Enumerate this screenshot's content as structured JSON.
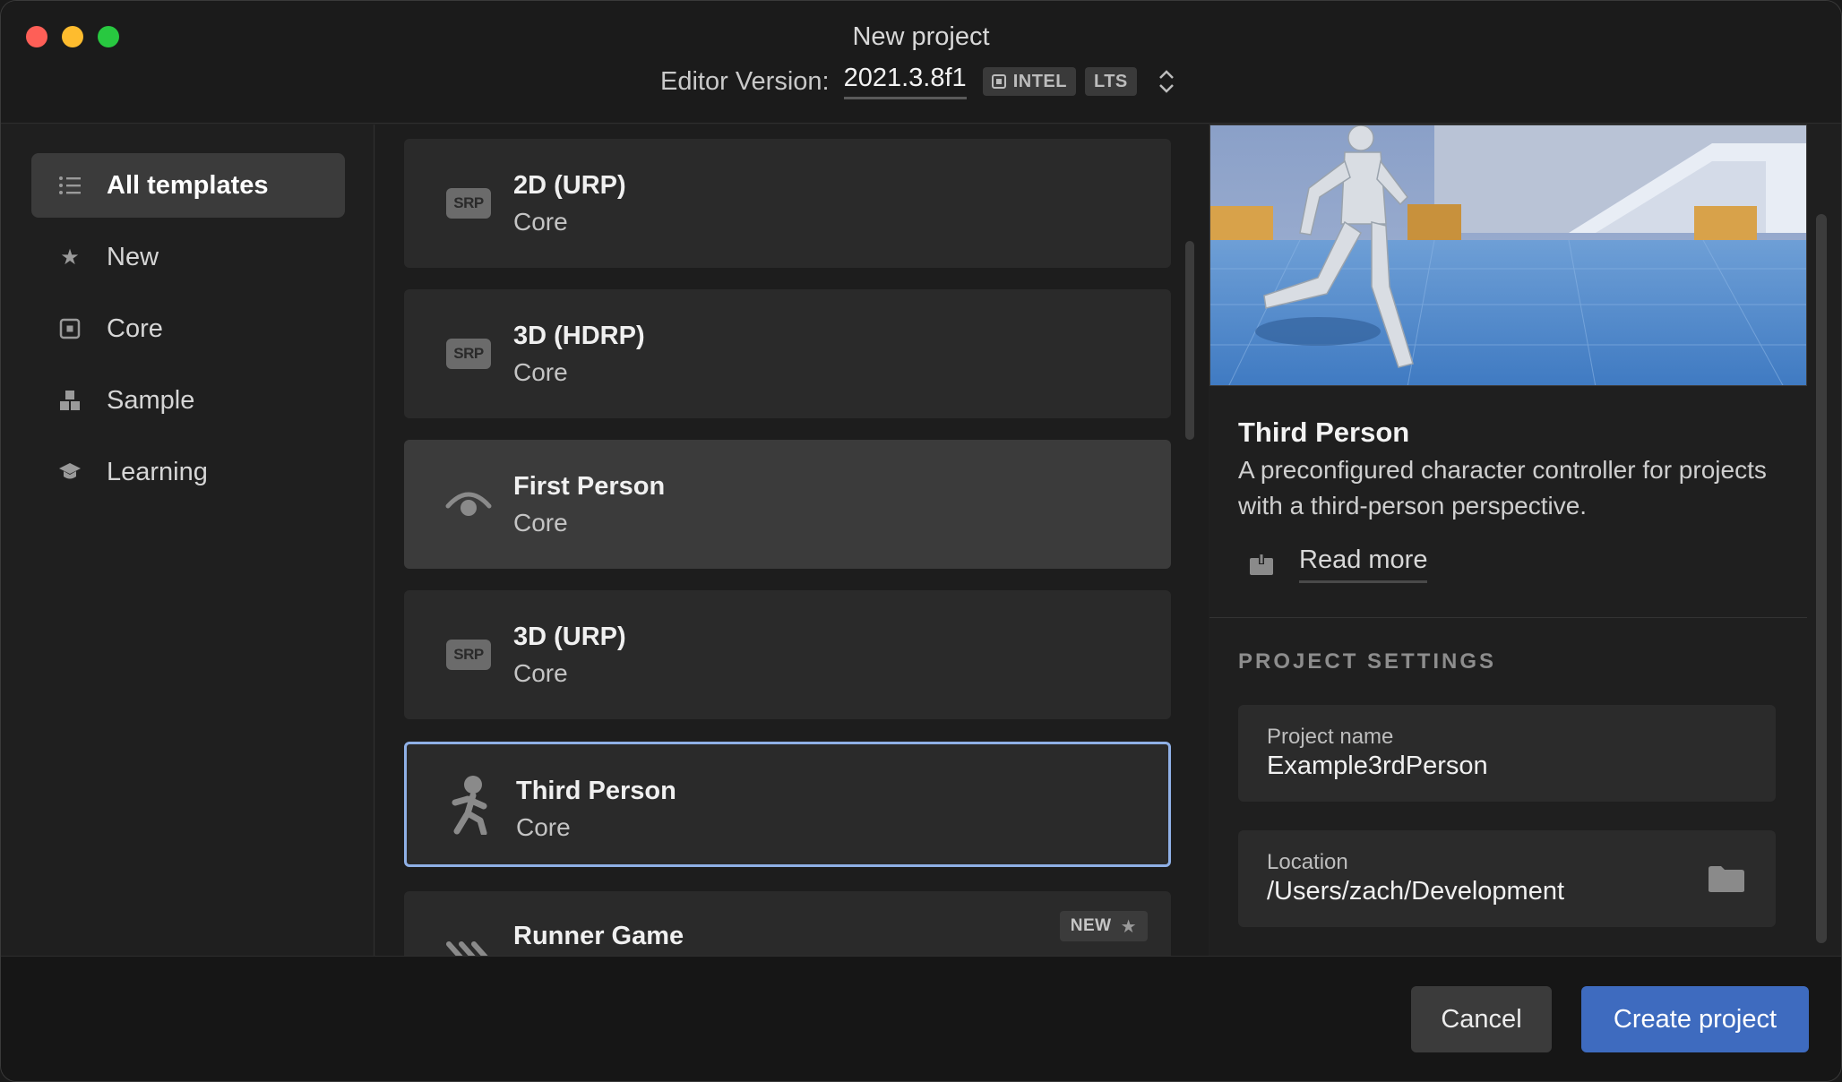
{
  "window": {
    "title": "New project",
    "editor_version_label": "Editor Version:",
    "editor_version": "2021.3.8f1",
    "arch_tag": "INTEL",
    "lts_tag": "LTS"
  },
  "sidebar": {
    "items": [
      {
        "label": "All templates",
        "icon": "list-icon",
        "active": true
      },
      {
        "label": "New",
        "icon": "star-icon",
        "active": false
      },
      {
        "label": "Core",
        "icon": "core-icon",
        "active": false
      },
      {
        "label": "Sample",
        "icon": "sample-icon",
        "active": false
      },
      {
        "label": "Learning",
        "icon": "graduation-cap-icon",
        "active": false
      }
    ]
  },
  "templates": [
    {
      "title": "2D (URP)",
      "subtitle": "Core",
      "icon": "srp-icon",
      "icon_text": "SRP",
      "state": "normal"
    },
    {
      "title": "3D (HDRP)",
      "subtitle": "Core",
      "icon": "srp-icon",
      "icon_text": "SRP",
      "state": "normal"
    },
    {
      "title": "First Person",
      "subtitle": "Core",
      "icon": "eye-icon",
      "state": "hover"
    },
    {
      "title": "3D (URP)",
      "subtitle": "Core",
      "icon": "srp-icon",
      "icon_text": "SRP",
      "state": "normal"
    },
    {
      "title": "Third Person",
      "subtitle": "Core",
      "icon": "running-person-icon",
      "state": "selected"
    },
    {
      "title": "Runner Game",
      "subtitle": "",
      "icon": "runner-icon",
      "state": "normal",
      "badge": "NEW"
    }
  ],
  "detail": {
    "title": "Third Person",
    "description": "A preconfigured character controller for projects with a third-person perspective.",
    "read_more": "Read more",
    "section_heading": "PROJECT SETTINGS",
    "project_name_label": "Project name",
    "project_name_value": "Example3rdPerson",
    "location_label": "Location",
    "location_value": "/Users/zach/Development"
  },
  "footer": {
    "cancel_label": "Cancel",
    "create_label": "Create project"
  },
  "colors": {
    "accent": "#3e6bbf",
    "selected_border": "#8fb0e6",
    "close": "#fe5f57",
    "minimize": "#febc2e",
    "maximize": "#28c840"
  }
}
